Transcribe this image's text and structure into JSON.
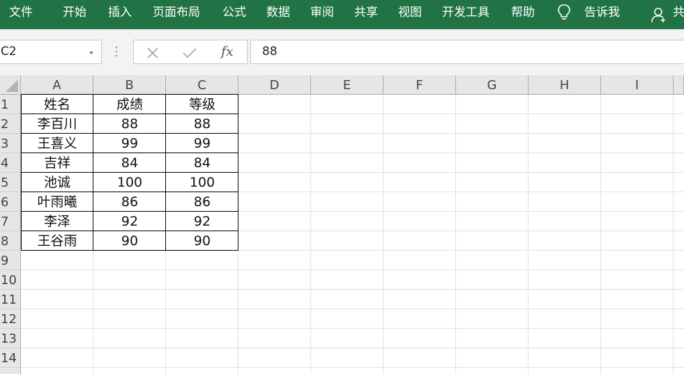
{
  "ribbon": {
    "tabs": [
      "文件",
      "开始",
      "插入",
      "页面布局",
      "公式",
      "数据",
      "审阅",
      "共享",
      "视图",
      "开发工具",
      "帮助"
    ],
    "tell_me": "告诉我",
    "share": "共"
  },
  "formula_bar": {
    "name_box": "C2",
    "fx_label": "fx",
    "content": "88"
  },
  "sheet": {
    "columns": [
      "A",
      "B",
      "C",
      "D",
      "E",
      "F",
      "G",
      "H",
      "I"
    ],
    "rows": [
      "1",
      "2",
      "3",
      "4",
      "5",
      "6",
      "7",
      "8",
      "9",
      "10",
      "11",
      "12",
      "13",
      "14"
    ],
    "selected_cell": "C2",
    "cells": [
      [
        "姓名",
        "成绩",
        "等级"
      ],
      [
        "李百川",
        "88",
        "88"
      ],
      [
        "王喜义",
        "99",
        "99"
      ],
      [
        "吉祥",
        "84",
        "84"
      ],
      [
        "池诚",
        "100",
        "100"
      ],
      [
        "叶雨曦",
        "86",
        "86"
      ],
      [
        "李泽",
        "92",
        "92"
      ],
      [
        "王谷雨",
        "90",
        "90"
      ]
    ]
  },
  "colors": {
    "ribbon": "#217346",
    "header_bg": "#e6e6e6",
    "gridline": "#e1e1e1"
  }
}
